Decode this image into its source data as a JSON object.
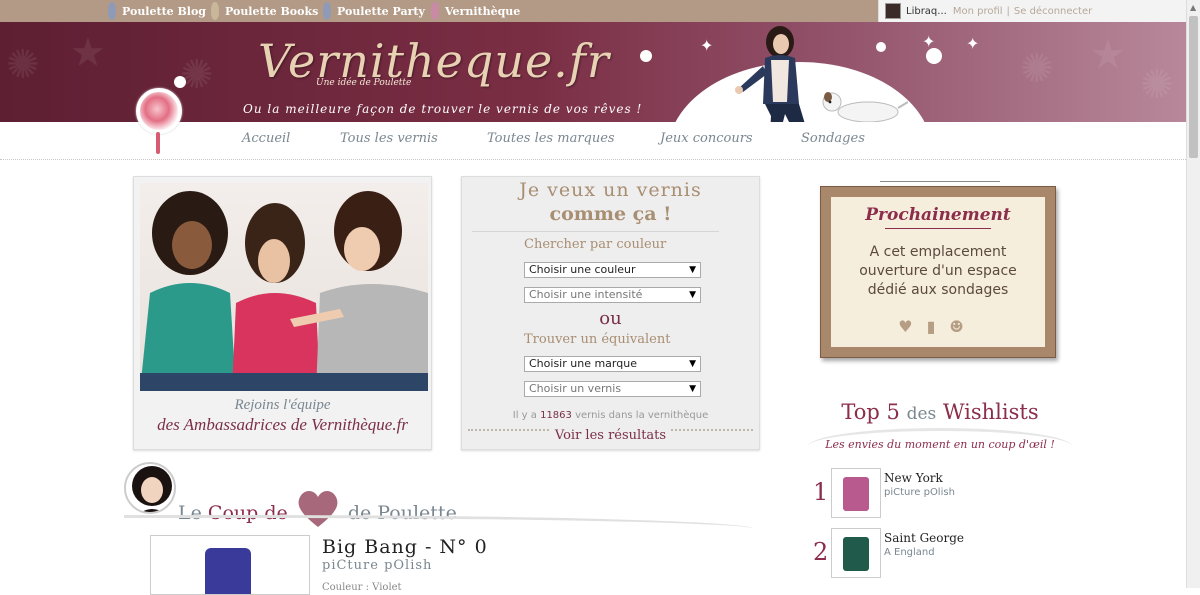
{
  "network": {
    "links": [
      {
        "label": "Poulette Blog",
        "color": "#9aa6c0"
      },
      {
        "label": "Poulette Books",
        "color": "#c9b79a"
      },
      {
        "label": "Poulette Party",
        "color": "#9aa6c0"
      },
      {
        "label": "Vernithèque",
        "color": "#c98aa6"
      }
    ]
  },
  "user": {
    "name": "Libraq...",
    "profile_link": "Mon profil",
    "logout_link": "Se déconnecter"
  },
  "header": {
    "logo": "Vernitheque.fr",
    "logo_sub": "Une idée de Poulette",
    "tagline": "Ou la meilleure façon de trouver le vernis de vos rêves !"
  },
  "nav": {
    "items": [
      "Accueil",
      "Tous les vernis",
      "Toutes les marques",
      "Jeux concours",
      "Sondages"
    ]
  },
  "ambassador": {
    "line1": "Rejoins l'équipe",
    "line2": "des Ambassadrices de Vernithèque.fr"
  },
  "search": {
    "title1": "Je veux un vernis",
    "title2": "comme ça !",
    "color_label": "Chercher par couleur",
    "color_select": "Choisir une couleur",
    "intensity_select": "Choisir une intensité",
    "or": "ou",
    "equiv_label": "Trouver un équivalent",
    "brand_select": "Choisir une marque",
    "polish_select": "Choisir un vernis",
    "count_prefix": "Il y a",
    "count": "11863",
    "count_suffix": "vernis dans la vernithèque",
    "results": "Voir les résultats"
  },
  "frame": {
    "title": "Prochainement",
    "line1": "A cet emplacement",
    "line2": "ouverture d'un espace",
    "line3": "dédié aux sondages"
  },
  "top5": {
    "title_top": "Top",
    "title_num": "5",
    "title_des": "des",
    "title_wish": "Wishlists",
    "subtitle": "Les envies du moment en un coup d'œil !",
    "items": [
      {
        "rank": "1",
        "name": "New York",
        "brand": "piCture pOlish",
        "color": "#b85a8e"
      },
      {
        "rank": "2",
        "name": "Saint George",
        "brand": "A England",
        "color": "#1f5a4a"
      }
    ]
  },
  "coup": {
    "le": "Le",
    "coup": "Coup de",
    "de": "de Poulette"
  },
  "product": {
    "title": "Big Bang - N° 0",
    "brand": "piCture pOlish",
    "color_line": "Couleur : Violet"
  }
}
